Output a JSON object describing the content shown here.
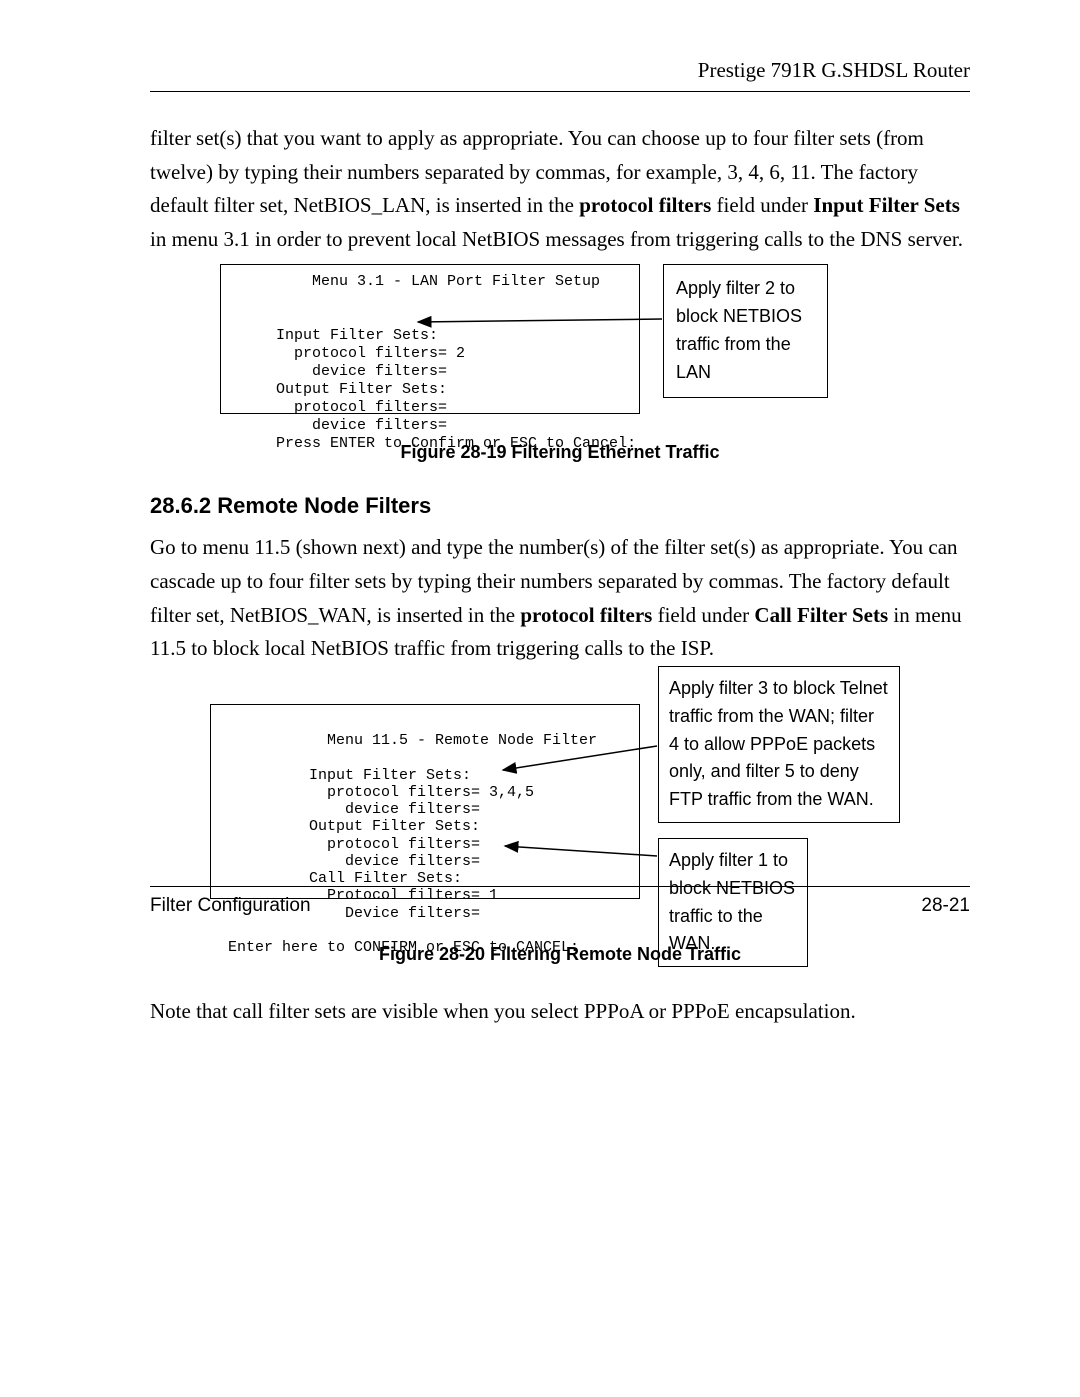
{
  "header": {
    "title": "Prestige 791R G.SHDSL Router"
  },
  "para1": {
    "t1": "filter set(s) that you want to apply as appropriate. You can choose up to four filter sets (from twelve) by typing their numbers separated by commas, for example, 3, 4, 6, 11. The factory default filter set, NetBIOS_LAN, is inserted in the ",
    "b1": "protocol filters",
    "t2": " field under ",
    "b2": "Input Filter Sets",
    "t3": " in menu 3.1 in order to prevent local NetBIOS messages from triggering calls to the DNS server."
  },
  "terminal1": "         Menu 3.1 - LAN Port Filter Setup\n\n\n     Input Filter Sets:\n       protocol filters= 2\n         device filters=\n     Output Filter Sets:\n       protocol filters=\n         device filters=\n     Press ENTER to Confirm or ESC to Cancel:",
  "callout1": "Apply filter 2 to block NETBIOS traffic from the LAN",
  "figcap1": "Figure 28-19 Filtering Ethernet Traffic",
  "heading": "28.6.2 Remote Node Filters",
  "para2": {
    "t1": "Go to menu 11.5 (shown next) and type the number(s) of the filter set(s) as appropriate. You can cascade up to four filter sets by typing their numbers separated by commas. The factory default filter set, NetBIOS_WAN, is inserted in the ",
    "b1": "protocol filters",
    "t2": " field under ",
    "b2": "Call Filter Sets",
    "t3": " in menu 11.5 to block local NetBIOS traffic from triggering calls to the ISP."
  },
  "terminal2": "\n            Menu 11.5 - Remote Node Filter\n\n          Input Filter Sets:\n            protocol filters= 3,4,5\n              device filters=\n          Output Filter Sets:\n            protocol filters=\n              device filters=\n          Call Filter Sets:\n            Protocol filters= 1\n              Device filters=\n\n Enter here to CONFIRM or ESC to CANCEL:",
  "callout2a": "Apply filter 3 to block Telnet traffic from the WAN; filter 4 to allow PPPoE packets only, and filter 5 to deny FTP traffic from the WAN.",
  "callout2b": "Apply filter 1 to block NETBIOS traffic to the WAN.",
  "figcap2": "Figure 28-20 Filtering Remote Node Traffic",
  "afternote": "Note that call filter sets are visible when you select PPPoA or PPPoE encapsulation.",
  "footer": {
    "left": "Filter Configuration",
    "right": "28-21"
  }
}
